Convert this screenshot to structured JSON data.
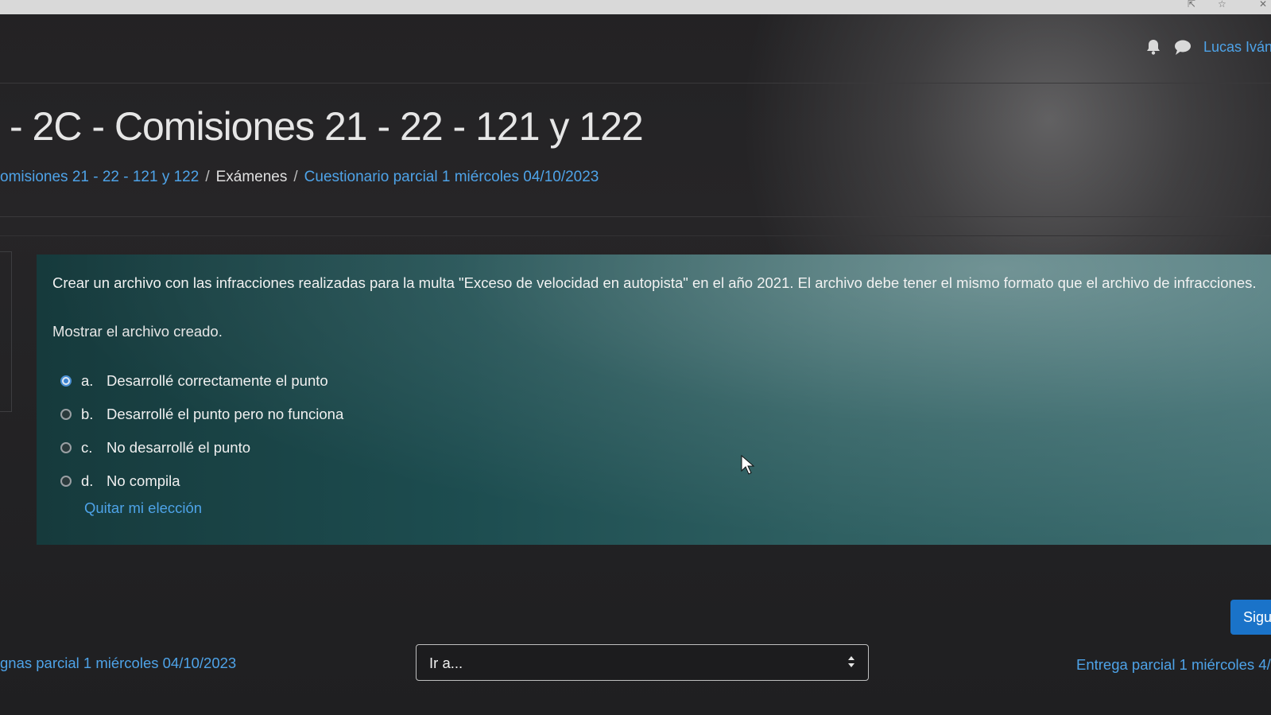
{
  "header": {
    "user_name": "Lucas Iván",
    "icons": [
      "bell-icon",
      "chat-icon"
    ]
  },
  "page": {
    "title": "- 2C - Comisiones 21 - 22 - 121 y 122"
  },
  "breadcrumb": {
    "items": [
      {
        "label": "omisiones 21 - 22 - 121 y 122",
        "link": true
      },
      {
        "label": "Exámenes",
        "link": false
      },
      {
        "label": "Cuestionario parcial 1 miércoles 04/10/2023",
        "link": true
      }
    ],
    "separator": "/"
  },
  "question": {
    "text": "Crear un archivo con las infracciones realizadas para la multa \"Exceso de velocidad en autopista\" en el año 2021. El archivo debe tener el mismo formato que el archivo de infracciones.",
    "text2": "Mostrar el archivo creado.",
    "answers": [
      {
        "letter": "a.",
        "label": "Desarrollé correctamente el punto",
        "selected": true
      },
      {
        "letter": "b.",
        "label": "Desarrollé el punto pero no funciona",
        "selected": false
      },
      {
        "letter": "c.",
        "label": "No desarrollé el punto",
        "selected": false
      },
      {
        "letter": "d.",
        "label": "No compila",
        "selected": false
      }
    ],
    "clear_choice_label": "Quitar mi elección"
  },
  "navigation": {
    "next_button_label": "Sigu",
    "prev_link_label": "gnas parcial 1 miércoles 04/10/2023",
    "jump_select_value": "Ir a...",
    "next_link_label": "Entrega parcial 1 miércoles 4/1"
  },
  "colors": {
    "link": "#4ea3e8",
    "primary_button": "#1a73c9",
    "question_bg": "#1d4d50",
    "page_bg": "#232224"
  }
}
